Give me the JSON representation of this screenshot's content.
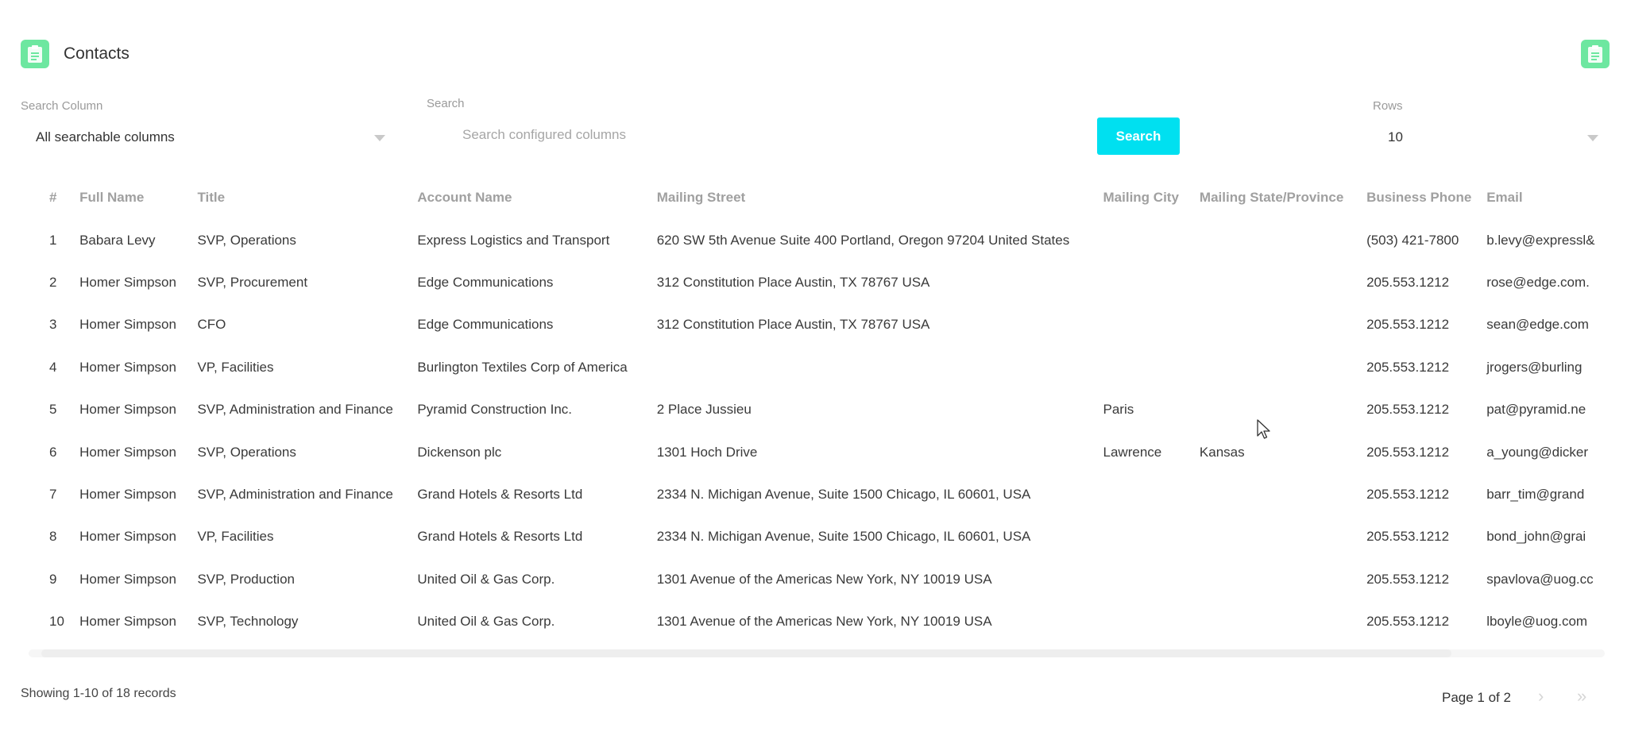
{
  "header": {
    "title": "Contacts",
    "icon": "clipboard-icon",
    "accent": "#6de7a0"
  },
  "filters": {
    "search_column_label": "Search Column",
    "search_column_value": "All searchable columns",
    "search_label": "Search",
    "search_placeholder": "Search configured columns",
    "search_value": "",
    "search_button": "Search",
    "search_button_color": "#00e0f0",
    "rows_label": "Rows",
    "rows_value": "10"
  },
  "table": {
    "columns": [
      "#",
      "Full Name",
      "Title",
      "Account Name",
      "Mailing Street",
      "Mailing City",
      "Mailing State/Province",
      "Business Phone",
      "Email"
    ],
    "rows": [
      [
        "1",
        "Babara Levy",
        "SVP, Operations",
        "Express Logistics and Transport",
        "620 SW 5th Avenue Suite 400 Portland, Oregon 97204 United States",
        "",
        "",
        "(503) 421-7800",
        "b.levy@expressl&"
      ],
      [
        "2",
        "Homer Simpson",
        "SVP, Procurement",
        "Edge Communications",
        "312 Constitution Place Austin, TX 78767 USA",
        "",
        "",
        "205.553.1212",
        "rose@edge.com."
      ],
      [
        "3",
        "Homer Simpson",
        "CFO",
        "Edge Communications",
        "312 Constitution Place Austin, TX 78767 USA",
        "",
        "",
        "205.553.1212",
        "sean@edge.com"
      ],
      [
        "4",
        "Homer Simpson",
        "VP, Facilities",
        "Burlington Textiles Corp of America",
        "",
        "",
        "",
        "205.553.1212",
        "jrogers@burling"
      ],
      [
        "5",
        "Homer Simpson",
        "SVP, Administration and Finance",
        "Pyramid Construction Inc.",
        "2 Place Jussieu",
        "Paris",
        "",
        "205.553.1212",
        "pat@pyramid.ne"
      ],
      [
        "6",
        "Homer Simpson",
        "SVP, Operations",
        "Dickenson plc",
        "1301 Hoch Drive",
        "Lawrence",
        "Kansas",
        "205.553.1212",
        "a_young@dicker"
      ],
      [
        "7",
        "Homer Simpson",
        "SVP, Administration and Finance",
        "Grand Hotels & Resorts Ltd",
        "2334 N. Michigan Avenue, Suite 1500 Chicago, IL 60601, USA",
        "",
        "",
        "205.553.1212",
        "barr_tim@grand"
      ],
      [
        "8",
        "Homer Simpson",
        "VP, Facilities",
        "Grand Hotels & Resorts Ltd",
        "2334 N. Michigan Avenue, Suite 1500 Chicago, IL 60601, USA",
        "",
        "",
        "205.553.1212",
        "bond_john@grai"
      ],
      [
        "9",
        "Homer Simpson",
        "SVP, Production",
        "United Oil & Gas Corp.",
        "1301 Avenue of the Americas New York, NY 10019 USA",
        "",
        "",
        "205.553.1212",
        "spavlova@uog.cc"
      ],
      [
        "10",
        "Homer Simpson",
        "SVP, Technology",
        "United Oil & Gas Corp.",
        "1301 Avenue of the Americas New York, NY 10019 USA",
        "",
        "",
        "205.553.1212",
        "lboyle@uog.com"
      ]
    ]
  },
  "footer": {
    "records_text": "Showing 1-10 of 18 records",
    "page_text": "Page 1 of 2",
    "next_icon": "chevron-right-icon",
    "last_icon": "double-chevron-right-icon"
  }
}
